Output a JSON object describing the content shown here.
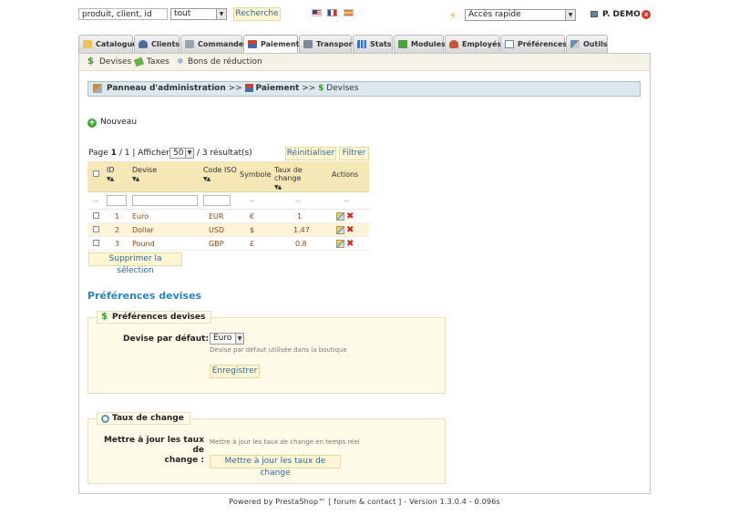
{
  "topbar": {
    "search_value": "produit, client, id",
    "filter_select": "tout",
    "search_button": "Recherche",
    "quick_access": "Accès rapide",
    "user_name": "P. DEMO"
  },
  "tabs": [
    {
      "label": "Catalogue"
    },
    {
      "label": "Clients"
    },
    {
      "label": "Commandes"
    },
    {
      "label": "Paiement"
    },
    {
      "label": "Transport"
    },
    {
      "label": "Stats"
    },
    {
      "label": "Modules"
    },
    {
      "label": "Employés"
    },
    {
      "label": "Préférences"
    },
    {
      "label": "Outils"
    }
  ],
  "subnav": {
    "devises": "Devises",
    "taxes": "Taxes",
    "bons": "Bons de réduction"
  },
  "breadcrumb": {
    "root": "Panneau d'administration",
    "sep": ">>",
    "section": "Paiement",
    "current": "Devises"
  },
  "actions": {
    "new": "Nouveau",
    "reset": "Réinitialiser",
    "filter": "Filtrer",
    "delete_selection": "Supprimer la sélection"
  },
  "pagination": {
    "page_label": "Page",
    "page": "1",
    "sep": "/",
    "total_pages": "1",
    "show_label": "| Afficher",
    "per_page": "50",
    "results": "/ 3 résultat(s)"
  },
  "table": {
    "headers": {
      "id": "ID",
      "devise": "Devise",
      "iso": "Code ISO",
      "symbole": "Symbole",
      "taux": "Taux de change",
      "actions": "Actions"
    },
    "filter_dash": "--",
    "rows": [
      {
        "id": "1",
        "name": "Euro",
        "iso": "EUR",
        "symbol": "€",
        "rate": "1"
      },
      {
        "id": "2",
        "name": "Dollar",
        "iso": "USD",
        "symbol": "$",
        "rate": "1.47"
      },
      {
        "id": "3",
        "name": "Pound",
        "iso": "GBP",
        "symbol": "£",
        "rate": "0.8"
      }
    ]
  },
  "prefs": {
    "section_title": "Préférences devises",
    "legend": "Préférences devises",
    "default_label": "Devise par défaut:",
    "default_value": "Euro",
    "default_help": "Devise par défaut utilisée dans la boutique",
    "save_button": "Enregistrer"
  },
  "rates": {
    "legend": "Taux de change",
    "update_label_1": "Mettre à jour les taux de",
    "update_label_2": "change :",
    "update_help": "Mettre à jour les taux de change en temps réel",
    "update_button": "Mettre à jour les taux de change"
  },
  "footer": {
    "powered": "Powered by PrestaShop™ [ forum & contact ] - Version 1.3.0.4 - 0.096s"
  },
  "colors": {
    "accent_blue": "#2a85bd",
    "link_blue": "#2a6a9c",
    "row_alt": "#fdf4d9",
    "header_bg": "#f5e7b6",
    "delete_red": "#d2231b"
  }
}
